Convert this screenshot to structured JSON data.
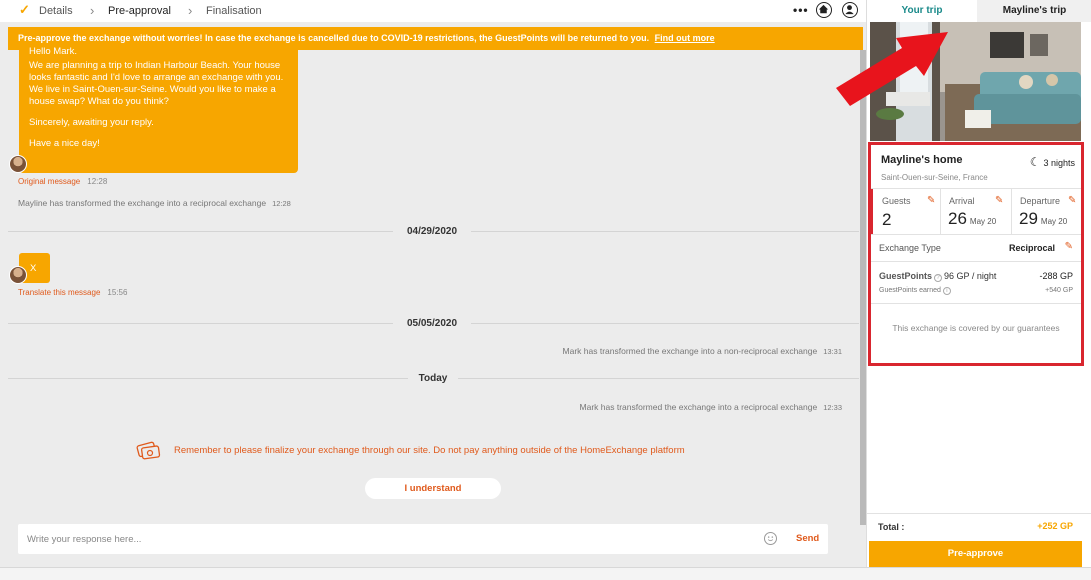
{
  "stepper": {
    "steps": [
      {
        "label": "Details"
      },
      {
        "label": "Pre-approval"
      },
      {
        "label": "Finalisation"
      }
    ]
  },
  "banner": {
    "text": "Pre-approve the exchange without worries! In case the exchange is cancelled due to COVID-19 restrictions, the GuestPoints will be returned to you.",
    "link": "Find out more"
  },
  "conversation": {
    "message1": {
      "greeting_partial": "Hello Mark,",
      "paragraphs": [
        "We are planning a trip to Indian Harbour Beach. Your house looks fantastic and I'd love to arrange an exchange with you. We live in Saint-Ouen-sur-Seine. Would you like to make a house swap? What do you think?",
        "Sincerely, awaiting your reply.",
        "Have a nice day!"
      ],
      "meta_link": "Original message",
      "time": "12:28"
    },
    "system1": {
      "text": "Mayline has transformed the exchange into a reciprocal exchange",
      "time": "12:28"
    },
    "date1": "04/29/2020",
    "message2": {
      "text": "X",
      "meta_link": "Translate this message",
      "time": "15:56"
    },
    "date2": "05/05/2020",
    "system2": {
      "text": "Mark has transformed the exchange into a non-reciprocal exchange",
      "time": "13:31"
    },
    "date3": "Today",
    "system3": {
      "text": "Mark has transformed the exchange into a reciprocal exchange",
      "time": "12:33"
    },
    "reminder": "Remember to please finalize your exchange through our site. Do not pay anything outside of the HomeExchange platform",
    "understand_label": "I understand",
    "composer_placeholder": "Write your response here...",
    "send_label": "Send"
  },
  "trip": {
    "tabs": [
      {
        "label": "Your trip",
        "active": true
      },
      {
        "label": "Mayline's trip",
        "active": false
      }
    ],
    "home_name": "Mayline's home",
    "home_city": "Saint-Ouen-sur-Seine, France",
    "nights": "3 nights",
    "guests": {
      "label": "Guests",
      "value": "2"
    },
    "arrival": {
      "label": "Arrival",
      "day": "26",
      "month": "May 20"
    },
    "departure": {
      "label": "Departure",
      "day": "29",
      "month": "May 20"
    },
    "exchange_type": {
      "label": "Exchange Type",
      "value": "Reciprocal"
    },
    "guestpoints": {
      "label": "GuestPoints",
      "rate": "96 GP / night",
      "amount": "-288 GP"
    },
    "guestpoints_earned": {
      "label": "GuestPoints earned",
      "amount": "+540 GP"
    },
    "guarantee": "This exchange is covered by our guarantees",
    "total": {
      "label": "Total :",
      "value": "+252 GP"
    },
    "preapprove_label": "Pre-approve"
  },
  "colors": {
    "accent_orange": "#f7a600",
    "link_orange": "#e05a1c",
    "teal": "#1a8a8a",
    "highlight_red": "#d9262f",
    "annotation_arrow": "#e8141c"
  },
  "icons": [
    "check-icon",
    "chevron-right-icon",
    "more-icon",
    "home-icon",
    "user-icon",
    "moon-icon",
    "pencil-icon",
    "info-icon",
    "cash-icon",
    "emoji-icon",
    "arrow-annotation"
  ]
}
